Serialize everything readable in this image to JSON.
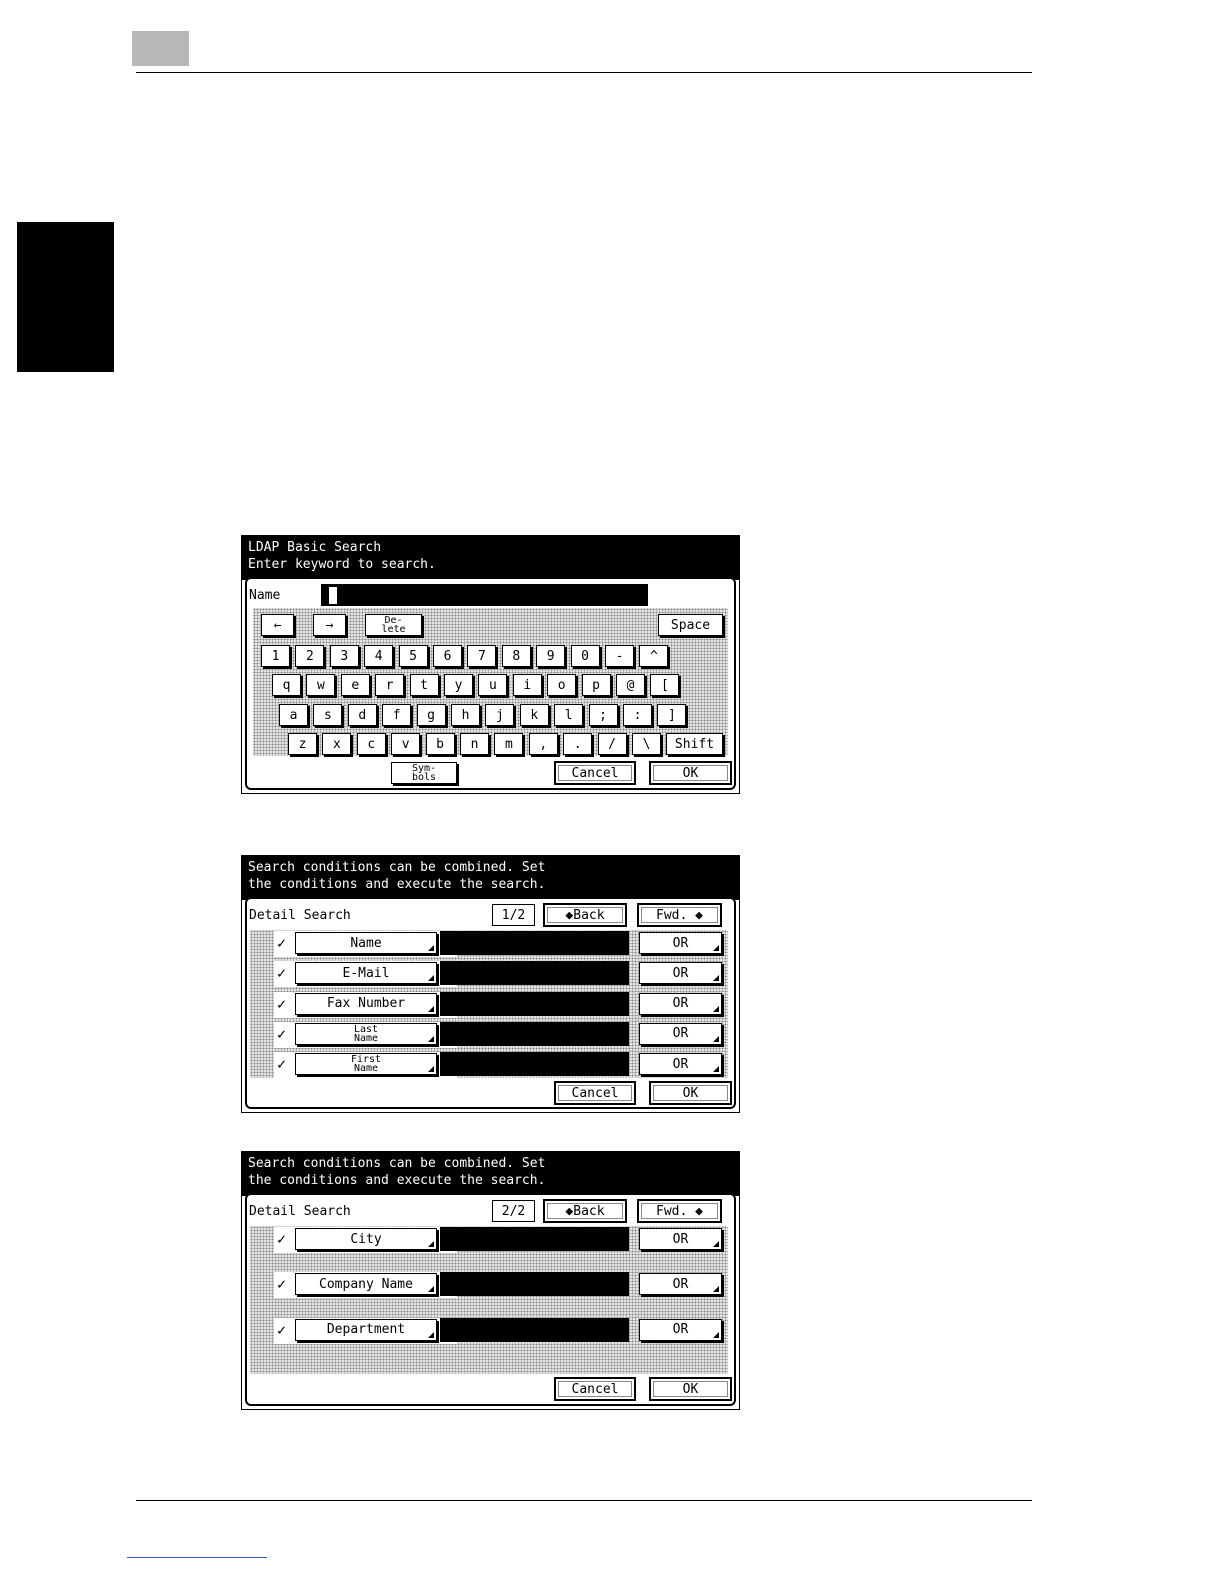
{
  "screen1": {
    "header": "LDAP Basic Search\nEnter keyword to search.",
    "field_label": "Name",
    "left_arrow": "←",
    "right_arrow": "→",
    "delete": "De-\nlete",
    "space": "Space",
    "row1": [
      "1",
      "2",
      "3",
      "4",
      "5",
      "6",
      "7",
      "8",
      "9",
      "0",
      "-",
      "^"
    ],
    "row2": [
      "q",
      "w",
      "e",
      "r",
      "t",
      "y",
      "u",
      "i",
      "o",
      "p",
      "@",
      "["
    ],
    "row3": [
      "a",
      "s",
      "d",
      "f",
      "g",
      "h",
      "j",
      "k",
      "l",
      ";",
      ":",
      "]"
    ],
    "row4": [
      "z",
      "x",
      "c",
      "v",
      "b",
      "n",
      "m",
      ",",
      ".",
      "/",
      "\\"
    ],
    "shift": "Shift",
    "symbols": "Sym-\nbols",
    "cancel": "Cancel",
    "ok": "OK"
  },
  "screen2": {
    "header": "Search conditions can be combined. Set\nthe conditions and execute the search.",
    "title": "Detail Search",
    "page": "1/2",
    "back": "◆Back",
    "fwd": "Fwd. ◆",
    "rows": [
      {
        "check": "✓",
        "label": "Name",
        "op": "OR"
      },
      {
        "check": "✓",
        "label": "E-Mail",
        "op": "OR"
      },
      {
        "check": "✓",
        "label": "Fax Number",
        "op": "OR"
      },
      {
        "check": "✓",
        "label": "Last\nName",
        "op": "OR"
      },
      {
        "check": "✓",
        "label": "First\nName",
        "op": "OR"
      }
    ],
    "cancel": "Cancel",
    "ok": "OK"
  },
  "screen3": {
    "header": "Search conditions can be combined. Set\nthe conditions and execute the search.",
    "title": "Detail Search",
    "page": "2/2",
    "back": "◆Back",
    "fwd": "Fwd. ◆",
    "rows": [
      {
        "check": "✓",
        "label": "City",
        "op": "OR"
      },
      {
        "check": "✓",
        "label": "Company Name",
        "op": "OR"
      },
      {
        "check": "✓",
        "label": "Department",
        "op": "OR"
      }
    ],
    "cancel": "Cancel",
    "ok": "OK"
  }
}
